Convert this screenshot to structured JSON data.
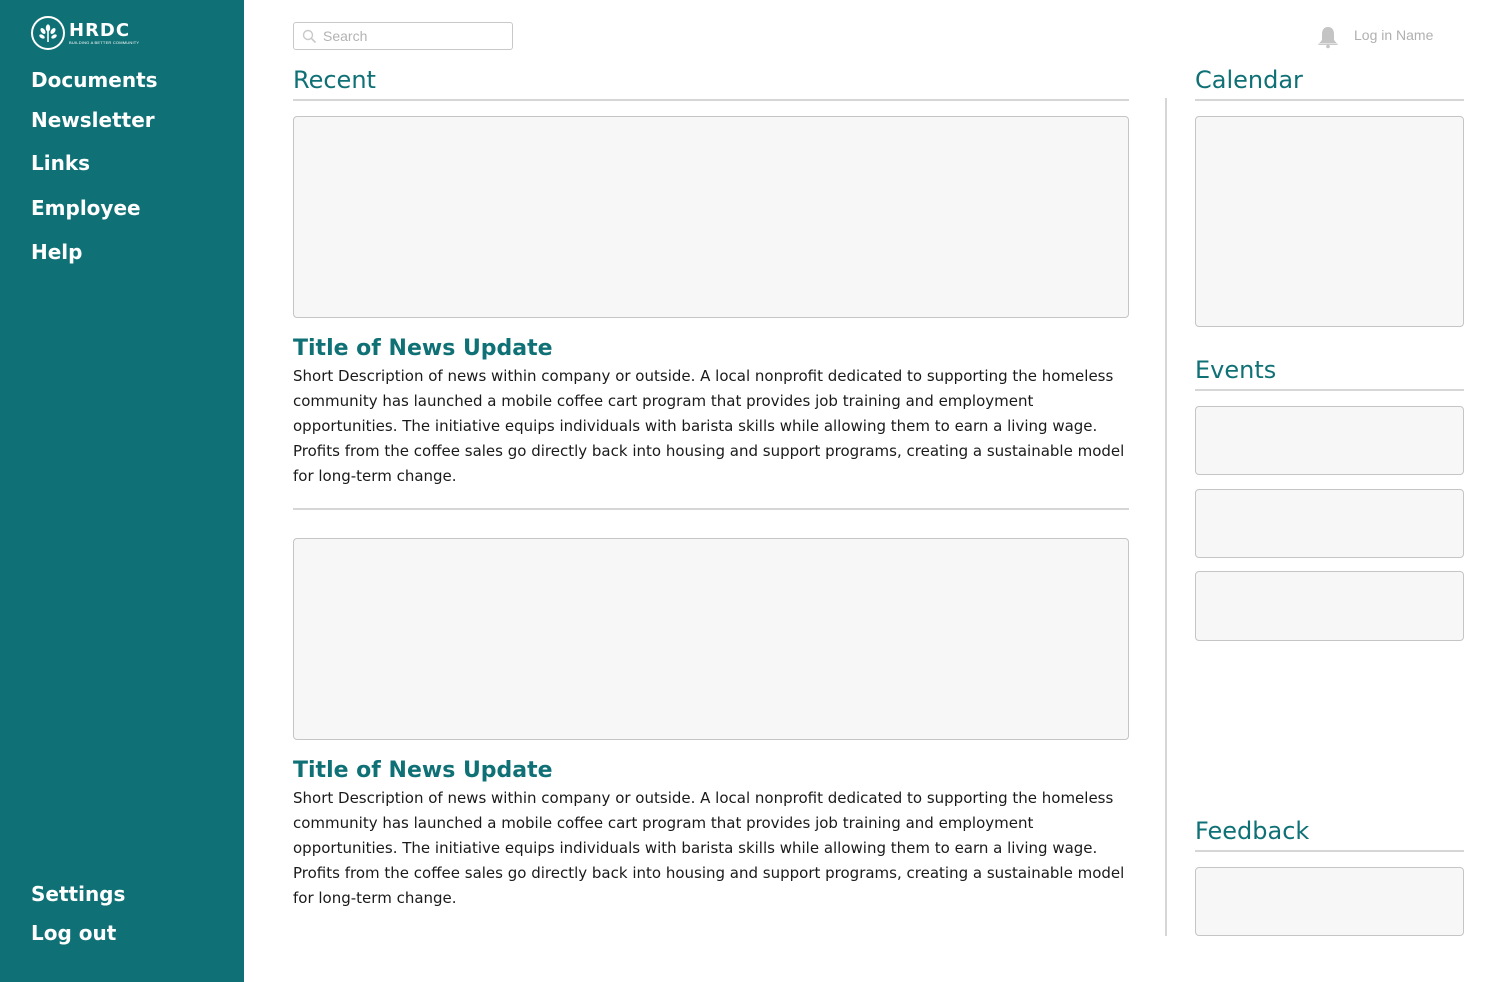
{
  "brand": {
    "name": "HRDC",
    "tagline": "BUILDING A BETTER COMMUNITY"
  },
  "sidebar": {
    "items": [
      {
        "label": "Documents"
      },
      {
        "label": "Newsletter"
      },
      {
        "label": "Links"
      },
      {
        "label": "Employee"
      },
      {
        "label": "Help"
      }
    ],
    "footer_items": [
      {
        "label": "Settings"
      },
      {
        "label": "Log out"
      }
    ]
  },
  "header": {
    "search_placeholder": "Search",
    "login_name": "Log in Name",
    "icons": [
      "search-icon",
      "bell-icon"
    ]
  },
  "main": {
    "recent_title": "Recent",
    "news": [
      {
        "title": "Title of News Update",
        "description": "Short Description of news within company or outside. A local nonprofit dedicated to supporting the homeless community has launched a mobile coffee cart program that provides job training and employment opportunities. The initiative equips individuals with barista skills while allowing them to earn a living wage. Profits from the coffee sales go directly back into housing and support programs, creating a sustainable model for long-term change."
      },
      {
        "title": "Title of News Update",
        "description": "Short Description of news within company or outside. A local nonprofit dedicated to supporting the homeless community has launched a mobile coffee cart program that provides job training and employment opportunities. The initiative equips individuals with barista skills while allowing them to earn a living wage. Profits from the coffee sales go directly back into housing and support programs, creating a sustainable model for long-term change."
      }
    ]
  },
  "right": {
    "calendar_title": "Calendar",
    "events_title": "Events",
    "feedback_title": "Feedback"
  },
  "colors": {
    "brand_teal": "#0f7175",
    "placeholder_fill": "#f7f7f7",
    "divider": "#d6d6d6"
  }
}
